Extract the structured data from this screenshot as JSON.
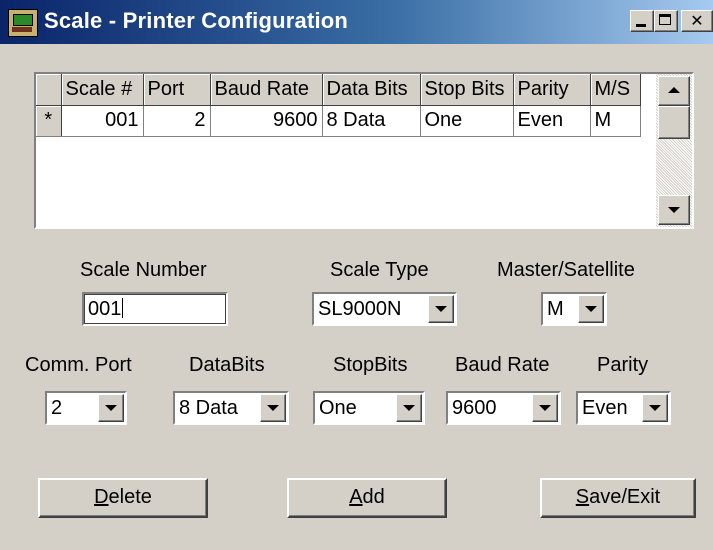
{
  "window": {
    "title": "Scale - Printer Configuration"
  },
  "grid": {
    "columns": [
      "Scale #",
      "Port",
      "Baud Rate",
      "Data Bits",
      "Stop Bits",
      "Parity",
      "M/S"
    ],
    "row_marker": "*",
    "rows": [
      {
        "scale": "001",
        "port": "2",
        "baud": "9600",
        "databits": "8 Data",
        "stopbits": "One",
        "parity": "Even",
        "ms": "M"
      }
    ]
  },
  "fields": {
    "scale_number": {
      "label": "Scale Number",
      "value": "001"
    },
    "scale_type": {
      "label": "Scale Type",
      "value": "SL9000N"
    },
    "master_satellite": {
      "label": "Master/Satellite",
      "value": "M"
    },
    "comm_port": {
      "label": "Comm. Port",
      "value": "2"
    },
    "databits": {
      "label": "DataBits",
      "value": "8 Data"
    },
    "stopbits": {
      "label": "StopBits",
      "value": "One"
    },
    "baud_rate": {
      "label": "Baud Rate",
      "value": "9600"
    },
    "parity": {
      "label": "Parity",
      "value": "Even"
    }
  },
  "buttons": {
    "delete": {
      "hotkey": "D",
      "rest": "elete"
    },
    "add": {
      "hotkey": "A",
      "rest": "dd"
    },
    "save": {
      "hotkey": "S",
      "rest": "ave/Exit"
    }
  },
  "icons": [
    "app-icon",
    "minimize-icon",
    "maximize-icon",
    "close-icon",
    "scroll-up-icon",
    "scroll-down-icon",
    "dropdown-arrow-icon"
  ]
}
